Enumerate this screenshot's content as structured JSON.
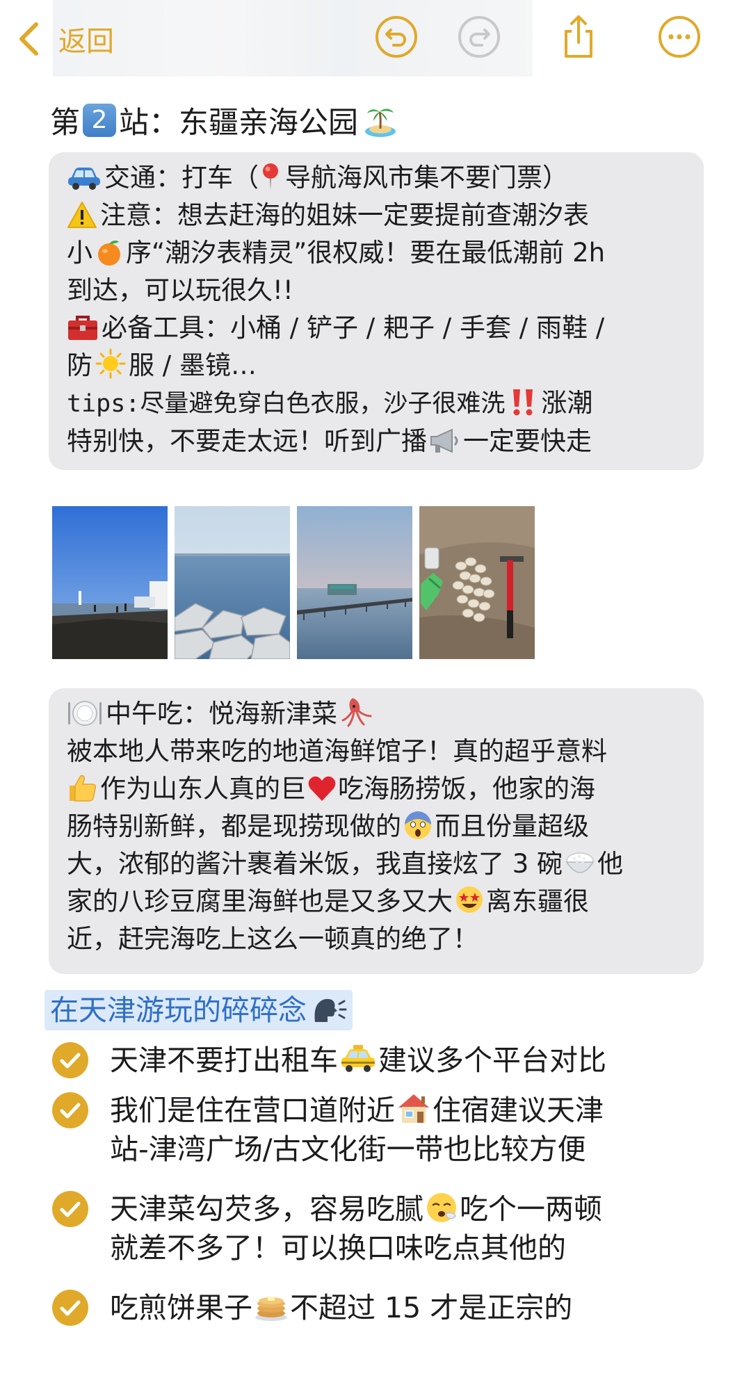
{
  "toolbar": {
    "back_label": "返回"
  },
  "station": {
    "prefix": "第",
    "number": "2",
    "suffix": "站：东疆亲海公园"
  },
  "transport_box": {
    "lines": [
      "交通：打车（",
      "导航海风市集不要门票）",
      "注意：想去赶海的姐妹一定要提前查潮汐表",
      "小",
      "序“潮汐表精灵”很权威！要在最低潮前 2h",
      "到达，可以玩很久!!",
      "必备工具：小桶 / 铲子 / 耙子 / 手套 / 雨鞋 /",
      "防",
      "服 / 墨镜…",
      "tips:尽量避免穿白色衣服，沙子很难洗",
      "涨潮",
      "特别快，不要走太远！听到广播",
      "一定要快走"
    ]
  },
  "photos": [
    {
      "name": "photo-pier-blue-sky"
    },
    {
      "name": "photo-sea-rocks"
    },
    {
      "name": "photo-long-pier"
    },
    {
      "name": "photo-clams-and-tools"
    }
  ],
  "lunch_box": {
    "title": "中午吃：悦海新津菜",
    "lines": [
      "被本地人带来吃的地道海鲜馆子！真的超乎意料",
      "作为山东人真的巨",
      "吃海肠捞饭，他家的海",
      "肠特别新鲜，都是现捞现做的",
      "而且份量超级",
      "大，浓郁的酱汁裹着米饭，我直接炫了 3 碗",
      "他",
      "家的八珍豆腐里海鲜也是又多又大",
      "离东疆很",
      "近，赶完海吃上这么一顿真的绝了！"
    ]
  },
  "section_heading": "在天津游玩的碎碎念",
  "checklist": [
    {
      "line1_a": "天津不要打出租车",
      "line1_b": "建议多个平台对比"
    },
    {
      "line1_a": "我们是住在营口道附近",
      "line1_b": "住宿建议天津",
      "line2": "站-津湾广场/古文化街一带也比较方便"
    },
    {
      "line1_a": "天津菜勾芡多，容易吃腻",
      "line1_b": "吃个一两顿",
      "line2": "就差不多了！可以换口味吃点其他的"
    },
    {
      "line1_a": "吃煎饼果子",
      "line1_b": "不超过 15 才是正宗的"
    }
  ],
  "colors": {
    "accent": "#e0a92a",
    "callout_bg": "#e9e9eb",
    "heading_bg": "#dbe9f9",
    "heading_text": "#2f6fc6"
  }
}
